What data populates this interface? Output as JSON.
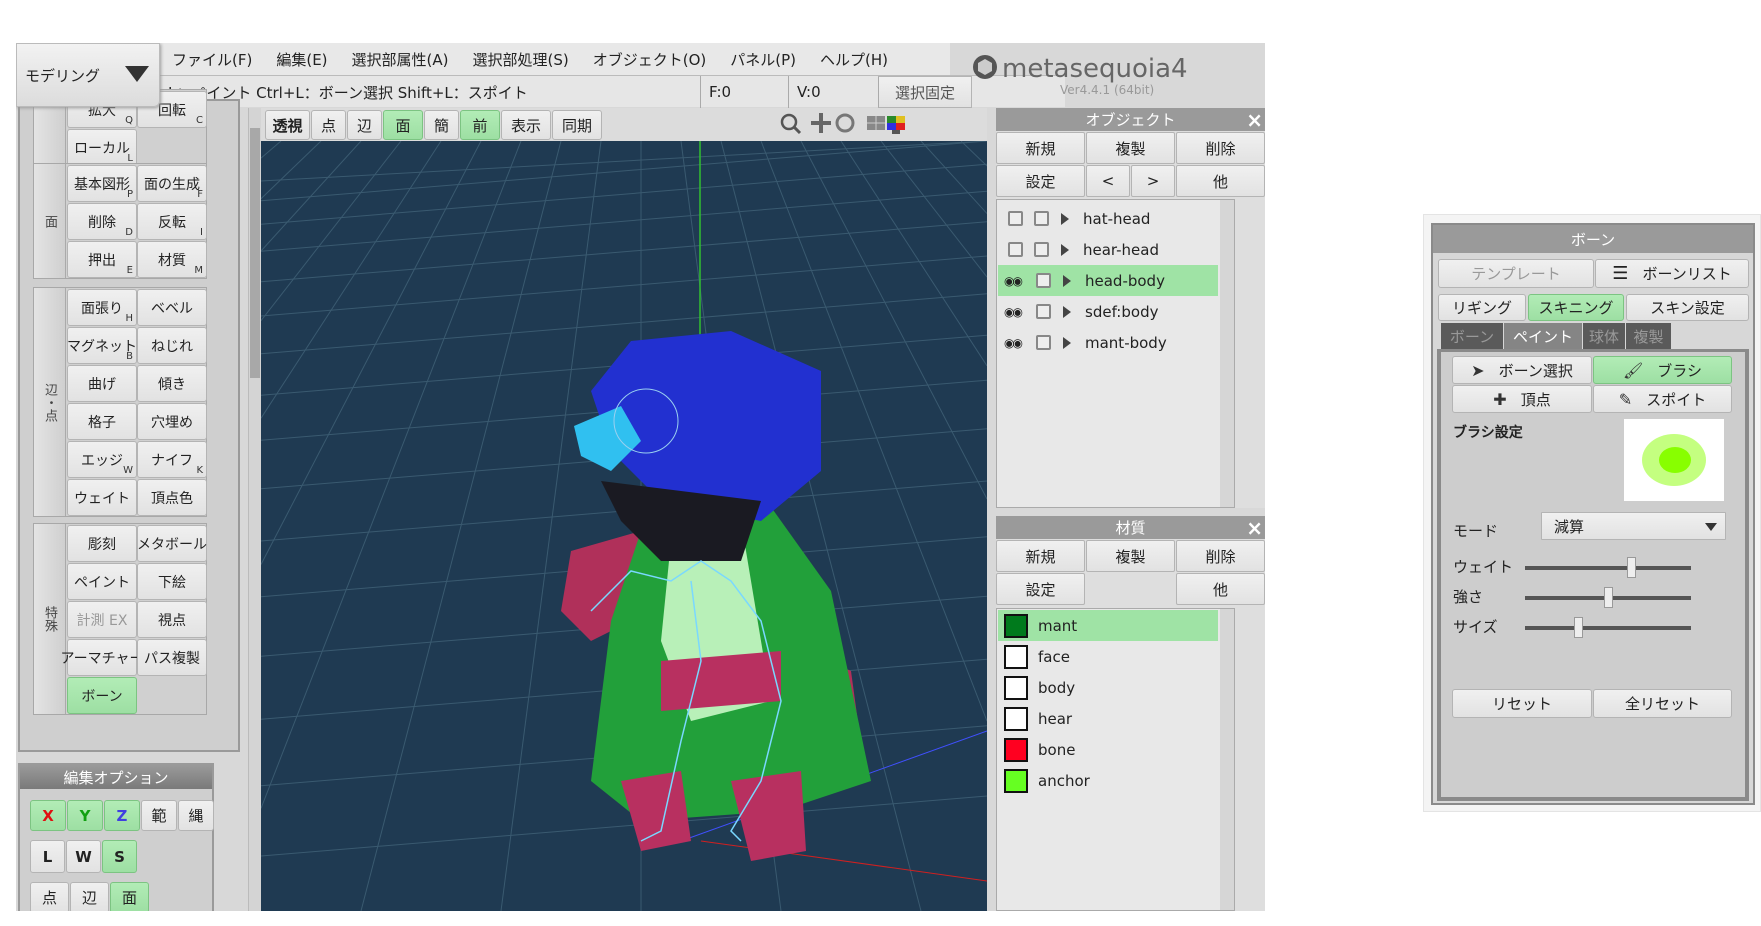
{
  "mode_selector": {
    "label": "モデリング"
  },
  "menu": [
    "ファイル(F)",
    "編集(E)",
    "選択部属性(A)",
    "選択部処理(S)",
    "オブジェクト(O)",
    "パネル(P)",
    "ヘルプ(H)"
  ],
  "status": {
    "hint": "L：ペイント  Ctrl+L：ボーン選択   Shift+L：スポイト",
    "faces": "F:0",
    "vertices": "V:0",
    "lock_selection": "選択固定"
  },
  "logo": {
    "name": "metasequoia4",
    "version": "Ver4.4.1 (64bit)"
  },
  "toolbar": {
    "groups": [
      {
        "label": "",
        "buttons": [
          {
            "label": "拡大",
            "key": "Q"
          },
          {
            "label": "回転",
            "key": "C"
          },
          {
            "label": "ローカル",
            "key": "L"
          }
        ]
      },
      {
        "label": "面",
        "buttons": [
          {
            "label": "基本図形",
            "key": "P"
          },
          {
            "label": "面の生成",
            "key": "F"
          },
          {
            "label": "削除",
            "key": "D"
          },
          {
            "label": "反転",
            "key": "I"
          },
          {
            "label": "押出",
            "key": "E"
          },
          {
            "label": "材質",
            "key": "M"
          }
        ]
      },
      {
        "label": "辺・点",
        "buttons": [
          {
            "label": "面張り",
            "key": "H"
          },
          {
            "label": "ベベル",
            "key": ""
          },
          {
            "label": "マグネット",
            "key": "B"
          },
          {
            "label": "ねじれ",
            "key": ""
          },
          {
            "label": "曲げ",
            "key": ""
          },
          {
            "label": "傾き",
            "key": ""
          },
          {
            "label": "格子",
            "key": ""
          },
          {
            "label": "穴埋め",
            "key": ""
          },
          {
            "label": "エッジ",
            "key": "W"
          },
          {
            "label": "ナイフ",
            "key": "K"
          },
          {
            "label": "ウェイト",
            "key": ""
          },
          {
            "label": "頂点色",
            "key": ""
          }
        ]
      },
      {
        "label": "特殊",
        "buttons": [
          {
            "label": "彫刻",
            "key": ""
          },
          {
            "label": "メタボール",
            "key": ""
          },
          {
            "label": "ペイント",
            "key": ""
          },
          {
            "label": "下絵",
            "key": ""
          },
          {
            "label": "計測 EX",
            "key": ""
          },
          {
            "label": "視点",
            "key": ""
          },
          {
            "label": "アーマチャー",
            "key": ""
          },
          {
            "label": "パス複製",
            "key": ""
          },
          {
            "label": "ボーン",
            "key": "",
            "active": true
          }
        ]
      }
    ]
  },
  "edit_options": {
    "title": "編集オプション",
    "axes": [
      {
        "label": "X",
        "color": "#e01010",
        "active": true
      },
      {
        "label": "Y",
        "color": "#10a010",
        "active": true
      },
      {
        "label": "Z",
        "color": "#4040e0",
        "active": true
      }
    ],
    "range": "範",
    "rope": "縄",
    "coord": [
      {
        "label": "L",
        "active": false
      },
      {
        "label": "W",
        "active": false
      },
      {
        "label": "S",
        "active": true
      }
    ],
    "select": [
      {
        "label": "点",
        "active": false
      },
      {
        "label": "辺",
        "active": false
      },
      {
        "label": "面",
        "active": true
      }
    ]
  },
  "view_toolbar": {
    "buttons": [
      {
        "label": "透視",
        "active": false,
        "bold": true
      },
      {
        "label": "点",
        "active": false
      },
      {
        "label": "辺",
        "active": false
      },
      {
        "label": "面",
        "active": true
      },
      {
        "label": "簡",
        "active": false
      },
      {
        "label": "前",
        "active": true
      },
      {
        "label": "表示",
        "active": false
      },
      {
        "label": "同期",
        "active": false
      }
    ],
    "icons": [
      "zoom-icon",
      "pan-icon",
      "rotate-icon",
      "single-view-icon",
      "quad-view-icon"
    ]
  },
  "object_panel": {
    "title": "オブジェクト",
    "buttons": [
      "新規",
      "複製",
      "削除",
      "設定",
      "<",
      ">",
      "他"
    ],
    "items": [
      {
        "name": "hat-head",
        "visible": false,
        "selected": false
      },
      {
        "name": "hear-head",
        "visible": false,
        "selected": false
      },
      {
        "name": "head-body",
        "visible": true,
        "selected": true
      },
      {
        "name": "sdef:body",
        "visible": true,
        "selected": false
      },
      {
        "name": "mant-body",
        "visible": true,
        "selected": false
      }
    ]
  },
  "material_panel": {
    "title": "材質",
    "buttons": [
      "新規",
      "複製",
      "削除",
      "設定",
      "他"
    ],
    "items": [
      {
        "name": "mant",
        "color": "#007a1c",
        "selected": true
      },
      {
        "name": "face",
        "color": "#ffffff"
      },
      {
        "name": "body",
        "color": "#ffffff"
      },
      {
        "name": "hear",
        "color": "#ffffff"
      },
      {
        "name": "bone",
        "color": "#ff0020"
      },
      {
        "name": "anchor",
        "color": "#66ff22"
      }
    ]
  },
  "bone_panel": {
    "title": "ボーン",
    "template": "テンプレート",
    "bone_list": "ボーンリスト",
    "modes": [
      {
        "label": "リギング",
        "active": false
      },
      {
        "label": "スキニング",
        "active": true
      },
      {
        "label": "スキン設定",
        "active": false
      }
    ],
    "tabs": [
      {
        "label": "ボーン",
        "active": false
      },
      {
        "label": "ペイント",
        "active": true
      },
      {
        "label": "球体",
        "active": false
      },
      {
        "label": "複製",
        "active": false
      }
    ],
    "tools": [
      {
        "label": "ボーン選択",
        "icon": "cursor-icon",
        "active": false
      },
      {
        "label": "ブラシ",
        "icon": "brush-icon",
        "active": true
      },
      {
        "label": "頂点",
        "icon": "vertex-icon",
        "active": false
      },
      {
        "label": "スポイト",
        "icon": "eyedropper-icon",
        "active": false
      }
    ],
    "brush_settings": "ブラシ設定",
    "mode_label": "モード",
    "mode_value": "減算",
    "sliders": [
      {
        "label": "ウェイト",
        "value": 0.64
      },
      {
        "label": "強さ",
        "value": 0.5
      },
      {
        "label": "サイズ",
        "value": 0.32
      }
    ],
    "reset": "リセット",
    "reset_all": "全リセット"
  }
}
